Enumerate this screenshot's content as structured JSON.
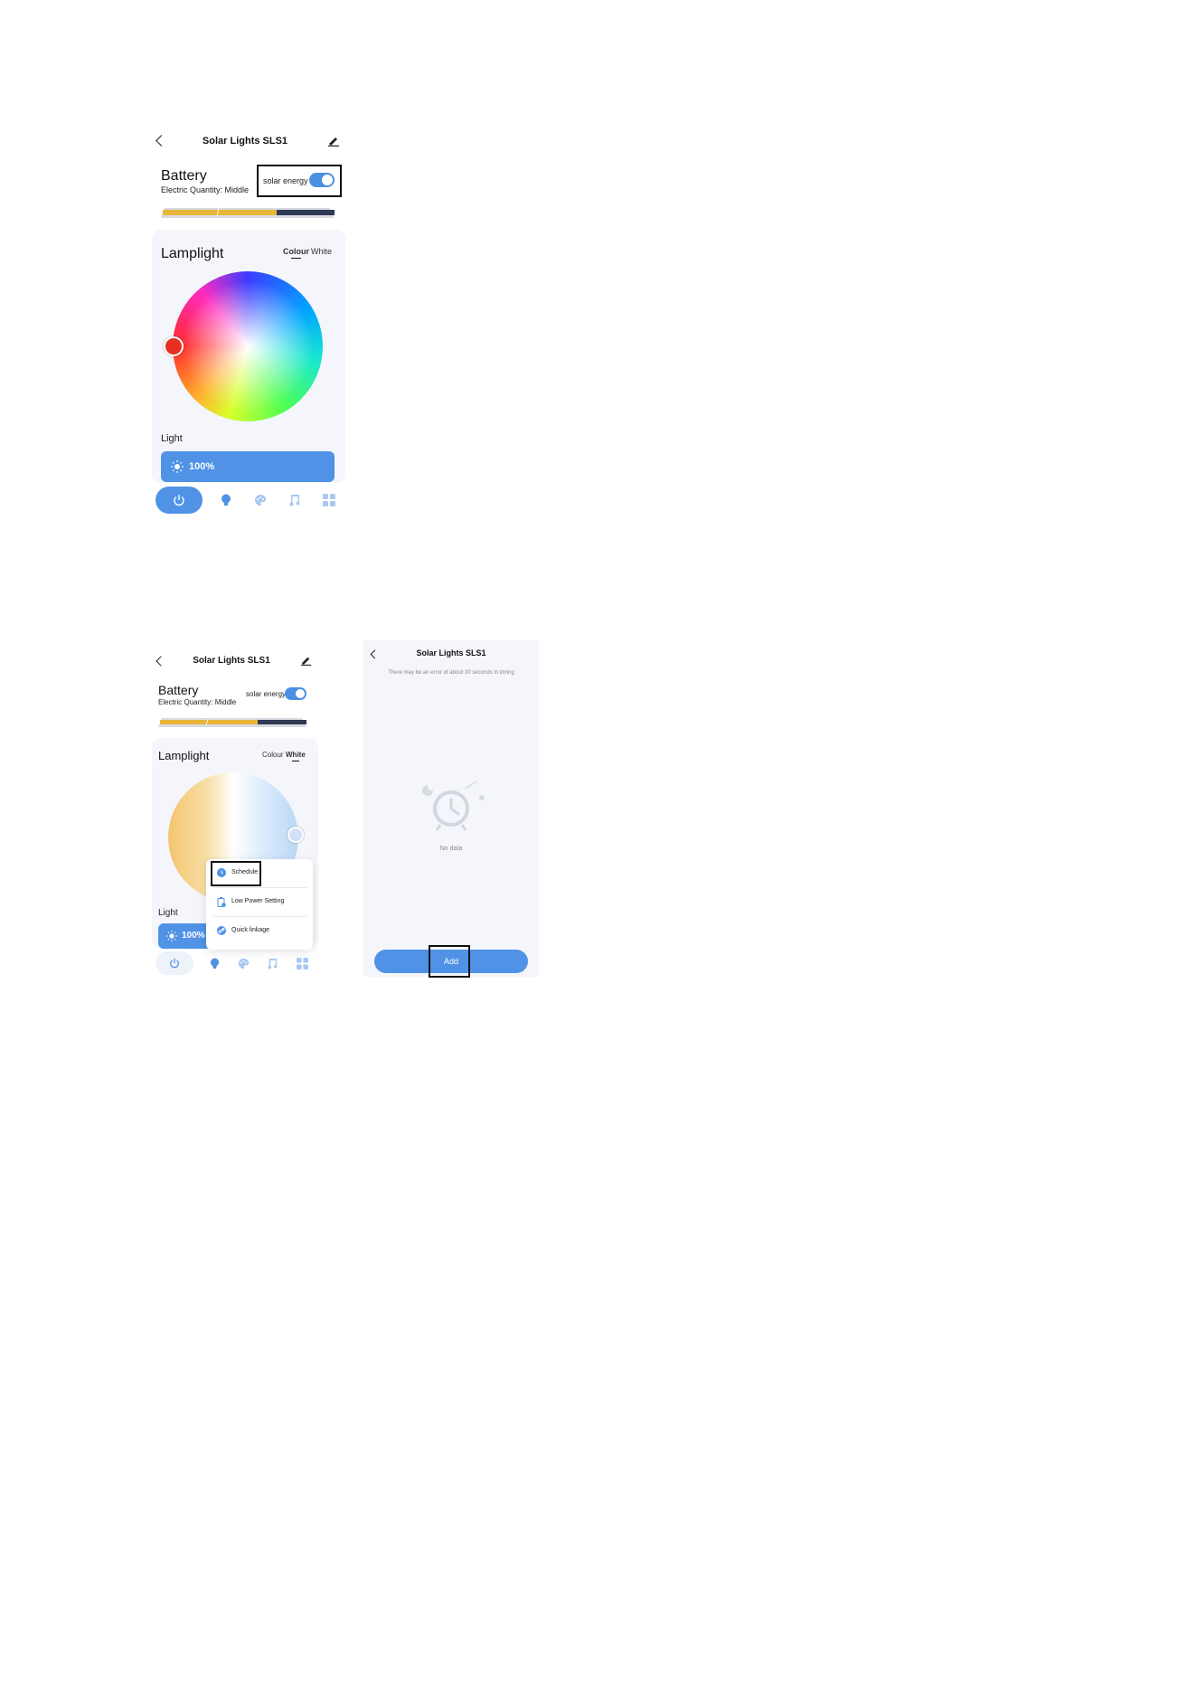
{
  "screen1": {
    "header": {
      "title": "Solar Lights SLS1"
    },
    "battery": {
      "title": "Battery",
      "subtitle": "Electric Quantity: Middle",
      "solar_label": "solar energy",
      "solar_on": true,
      "level": "Middle"
    },
    "lamplight": {
      "title": "Lamplight",
      "tabs": [
        "Colour",
        "White"
      ],
      "active_tab": "Colour"
    },
    "light": {
      "label": "Light",
      "value": "100%"
    },
    "nav": [
      "power-icon",
      "bulb-icon",
      "palette-icon",
      "music-icon",
      "grid-icon"
    ]
  },
  "screen2": {
    "header": {
      "title": "Solar Lights SLS1"
    },
    "battery": {
      "title": "Battery",
      "subtitle": "Electric Quantity: Middle",
      "solar_label": "solar energy",
      "solar_on": true
    },
    "lamplight": {
      "title": "Lamplight",
      "tabs": [
        "Colour",
        "White"
      ],
      "active_tab": "White"
    },
    "light": {
      "label": "Light",
      "value": "100%"
    },
    "menu": {
      "items": [
        "Schedule",
        "Low Power Setting",
        "Quick linkage"
      ]
    }
  },
  "screen3": {
    "header": {
      "title": "Solar Lights SLS1"
    },
    "note": "There may be an error of about 30 seconds in timing",
    "empty_text": "No data",
    "add_label": "Add"
  },
  "colors": {
    "accent": "#4f92e6",
    "card_bg": "#f4f6fb",
    "battery_yellow": "#e9b63c",
    "battery_dark": "#2f3a55"
  }
}
